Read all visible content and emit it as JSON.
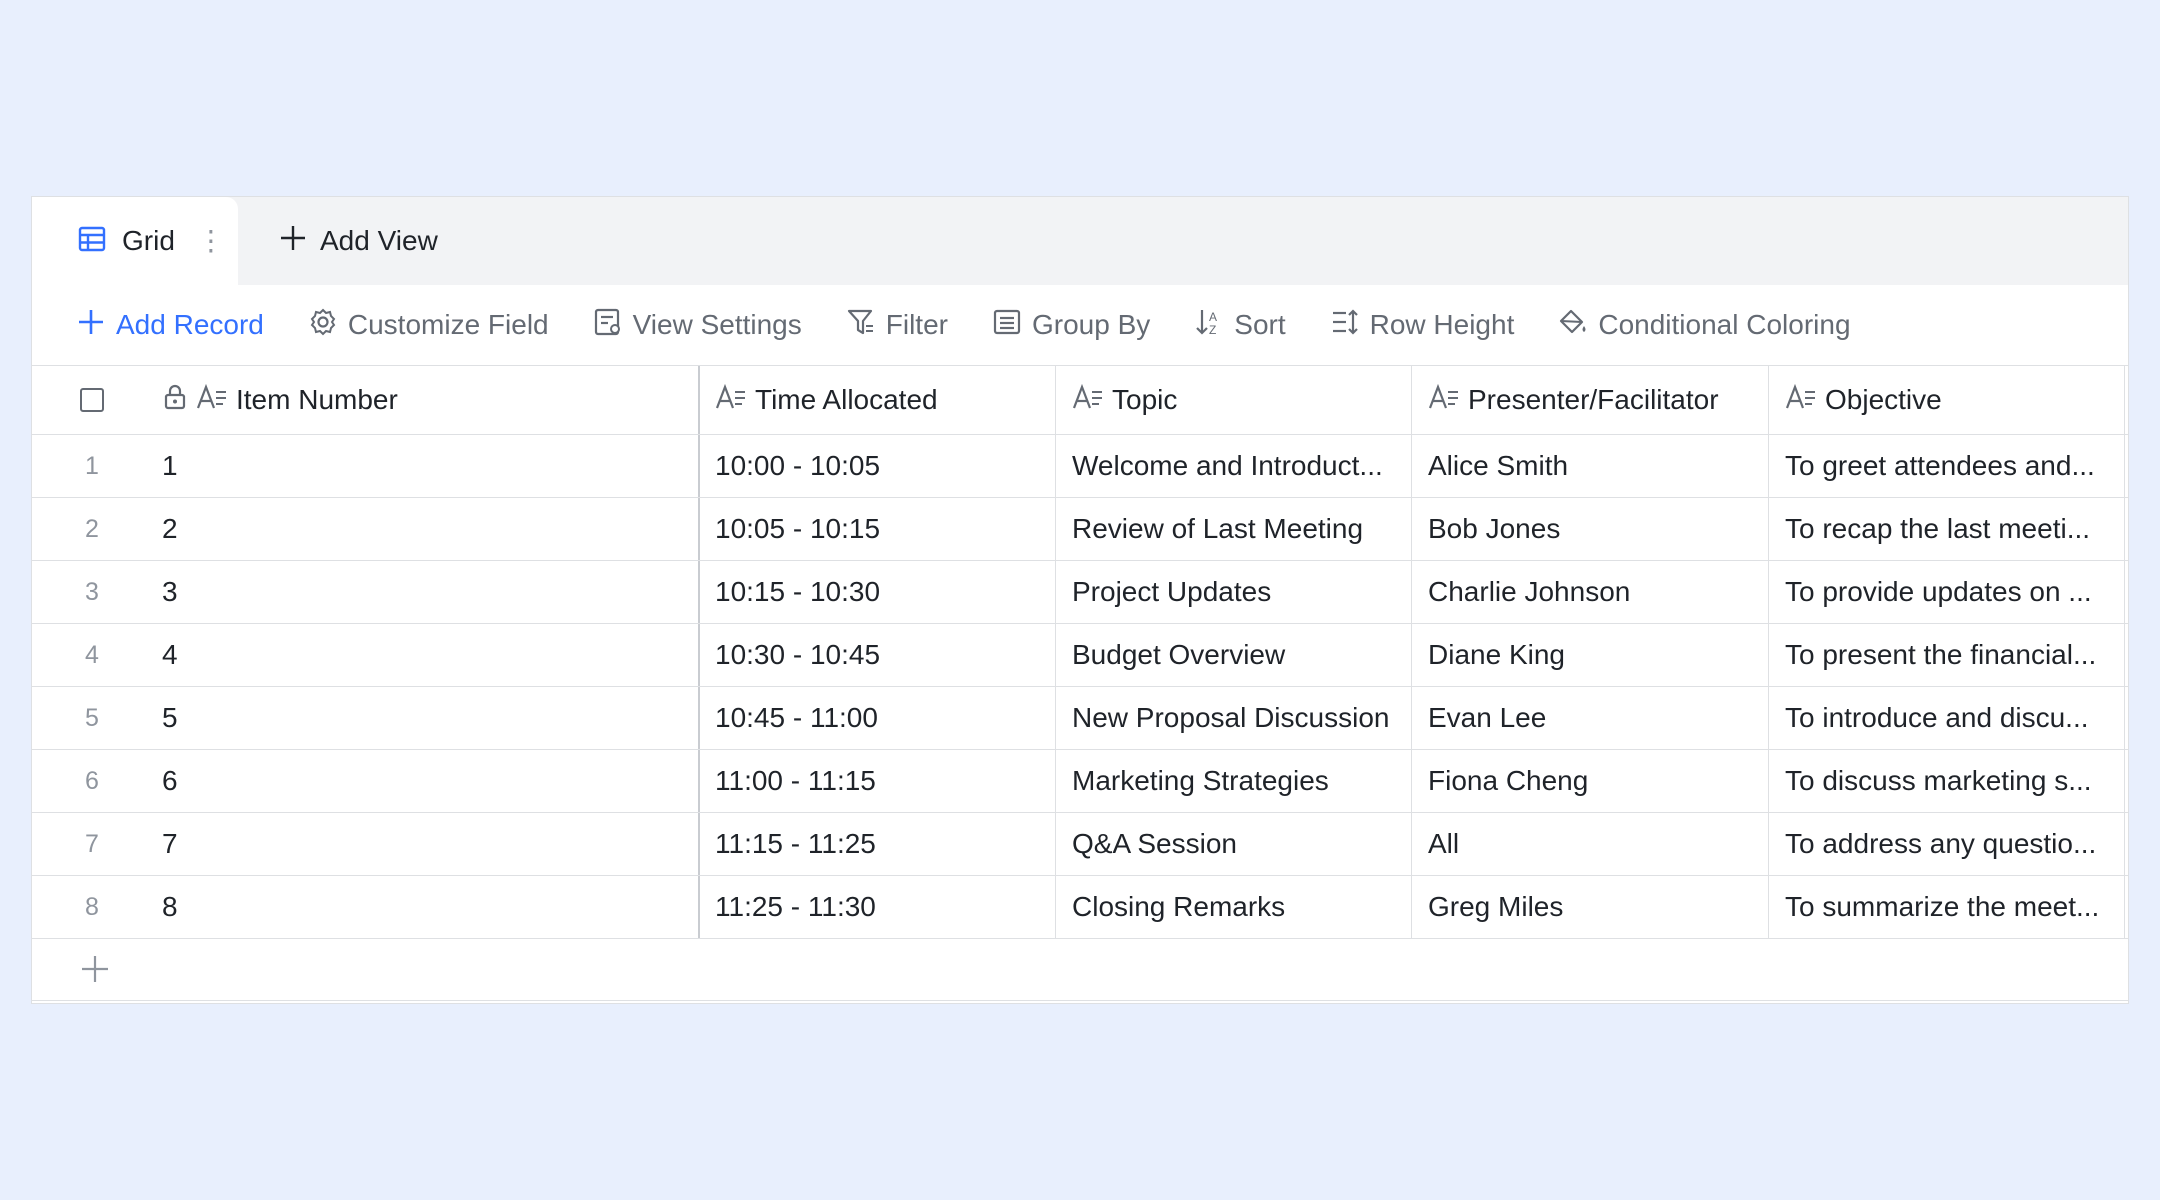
{
  "tabs": {
    "active_label": "Grid",
    "add_view_label": "Add View"
  },
  "toolbar": {
    "add_record": "Add Record",
    "customize_field": "Customize Field",
    "view_settings": "View Settings",
    "filter": "Filter",
    "group_by": "Group By",
    "sort": "Sort",
    "row_height": "Row Height",
    "conditional_coloring": "Conditional Coloring"
  },
  "colors": {
    "accent": "#3370ff",
    "background": "#e8effd"
  },
  "columns": [
    "Item Number",
    "Time Allocated",
    "Topic",
    "Presenter/Facilitator",
    "Objective"
  ],
  "rows": [
    {
      "num": "1",
      "item": "1",
      "time": "10:00 - 10:05",
      "topic": "Welcome and Introduct...",
      "presenter": "Alice Smith",
      "objective": "To greet attendees and..."
    },
    {
      "num": "2",
      "item": "2",
      "time": "10:05 - 10:15",
      "topic": "Review of Last Meeting",
      "presenter": "Bob Jones",
      "objective": "To recap the last meeti..."
    },
    {
      "num": "3",
      "item": "3",
      "time": "10:15 - 10:30",
      "topic": "Project Updates",
      "presenter": "Charlie Johnson",
      "objective": "To provide updates on ..."
    },
    {
      "num": "4",
      "item": "4",
      "time": "10:30 - 10:45",
      "topic": "Budget Overview",
      "presenter": "Diane King",
      "objective": "To present the financial..."
    },
    {
      "num": "5",
      "item": "5",
      "time": "10:45 - 11:00",
      "topic": "New Proposal Discussion",
      "presenter": "Evan Lee",
      "objective": "To introduce and discu..."
    },
    {
      "num": "6",
      "item": "6",
      "time": "11:00 - 11:15",
      "topic": "Marketing Strategies",
      "presenter": "Fiona Cheng",
      "objective": "To discuss marketing s..."
    },
    {
      "num": "7",
      "item": "7",
      "time": "11:15 - 11:25",
      "topic": "Q&A Session",
      "presenter": "All",
      "objective": "To address any questio..."
    },
    {
      "num": "8",
      "item": "8",
      "time": "11:25 - 11:30",
      "topic": "Closing Remarks",
      "presenter": "Greg Miles",
      "objective": "To summarize the meet..."
    }
  ]
}
